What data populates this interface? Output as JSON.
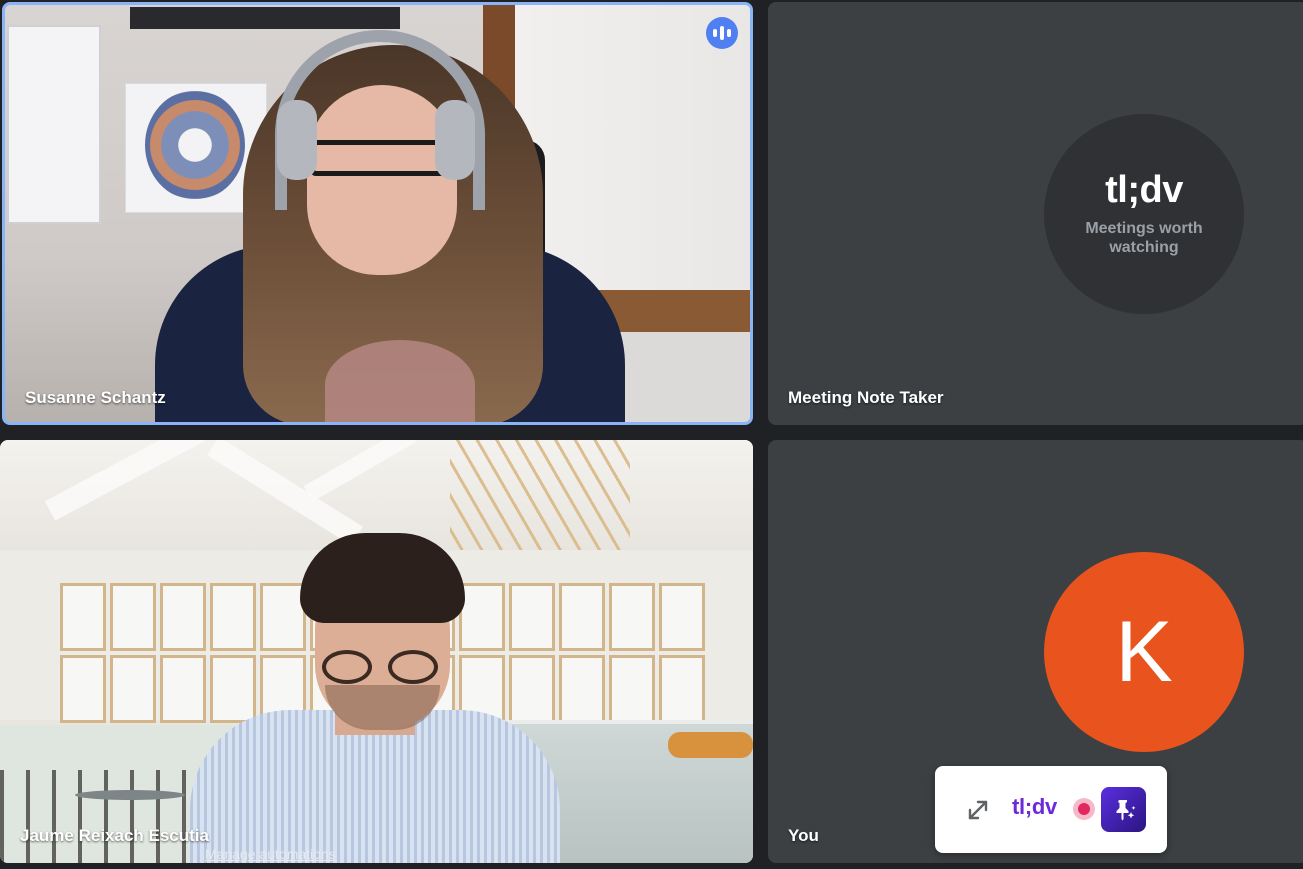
{
  "participants": {
    "susanne": {
      "name": "Susanne Schantz"
    },
    "notetaker": {
      "name": "Meeting Note Taker",
      "brand_logo": "tl;dv",
      "brand_tagline": "Meetings worth watching"
    },
    "jaume": {
      "name": "Jaume Reixach Escutia"
    },
    "you": {
      "name": "You",
      "avatar_initial": "K"
    }
  },
  "manage_link": "Manage automations",
  "widget": {
    "logo": "tl;dv",
    "icons": [
      "expand-icon",
      "record-indicator-icon",
      "pin-sparkle-icon"
    ]
  },
  "colors": {
    "active_speaker_border": "#8ab4f8",
    "speaking_badge": "#4f7ff0",
    "avatar_bg": "#e8531e",
    "tile_bg": "#3c4043",
    "brand_purple": "#6c2bd9",
    "record_red": "#e3285f"
  }
}
